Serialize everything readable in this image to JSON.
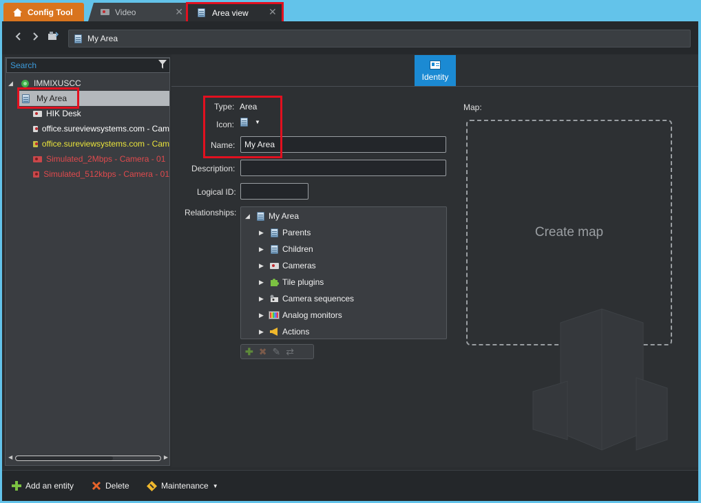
{
  "tabs": [
    {
      "label": "Config Tool",
      "icon": "home-icon"
    },
    {
      "label": "Video",
      "icon": "camera-icon"
    },
    {
      "label": "Area view",
      "icon": "area-icon"
    }
  ],
  "close_glyph": "✕",
  "address": {
    "text": "My Area"
  },
  "search": {
    "placeholder": "Search"
  },
  "tree": {
    "root": "IMMIXUSCC",
    "items": [
      {
        "label": "My Area",
        "color": "#1c1c1c"
      },
      {
        "label": "HIK Desk",
        "color": "#ffffff"
      },
      {
        "label": "office.sureviewsystems.com - Cam",
        "color": "#ffffff"
      },
      {
        "label": "office.sureviewsystems.com - Cam",
        "color": "#e9e33b"
      },
      {
        "label": "Simulated_2Mbps - Camera - 01",
        "color": "#e04a4d"
      },
      {
        "label": "Simulated_512kbps - Camera - 01",
        "color": "#e04a4d"
      }
    ]
  },
  "identity_tab": {
    "label": "Identity"
  },
  "form": {
    "type_label": "Type:",
    "type_value": "Area",
    "icon_label": "Icon:",
    "name_label": "Name:",
    "name_value": "My Area",
    "description_label": "Description:",
    "description_value": "",
    "logical_id_label": "Logical ID:",
    "logical_id_value": "",
    "relationships_label": "Relationships:"
  },
  "relationships": {
    "root": "My Area",
    "items": [
      "Parents",
      "Children",
      "Cameras",
      "Tile plugins",
      "Camera sequences",
      "Analog monitors",
      "Actions"
    ]
  },
  "map": {
    "label": "Map:",
    "create_text": "Create map"
  },
  "bottom": {
    "add_entity": "Add an entity",
    "delete": "Delete",
    "maintenance": "Maintenance"
  },
  "colors": {
    "accent": "#1b8ad3",
    "config_tab": "#d9741e",
    "highlight": "#e2101f"
  }
}
